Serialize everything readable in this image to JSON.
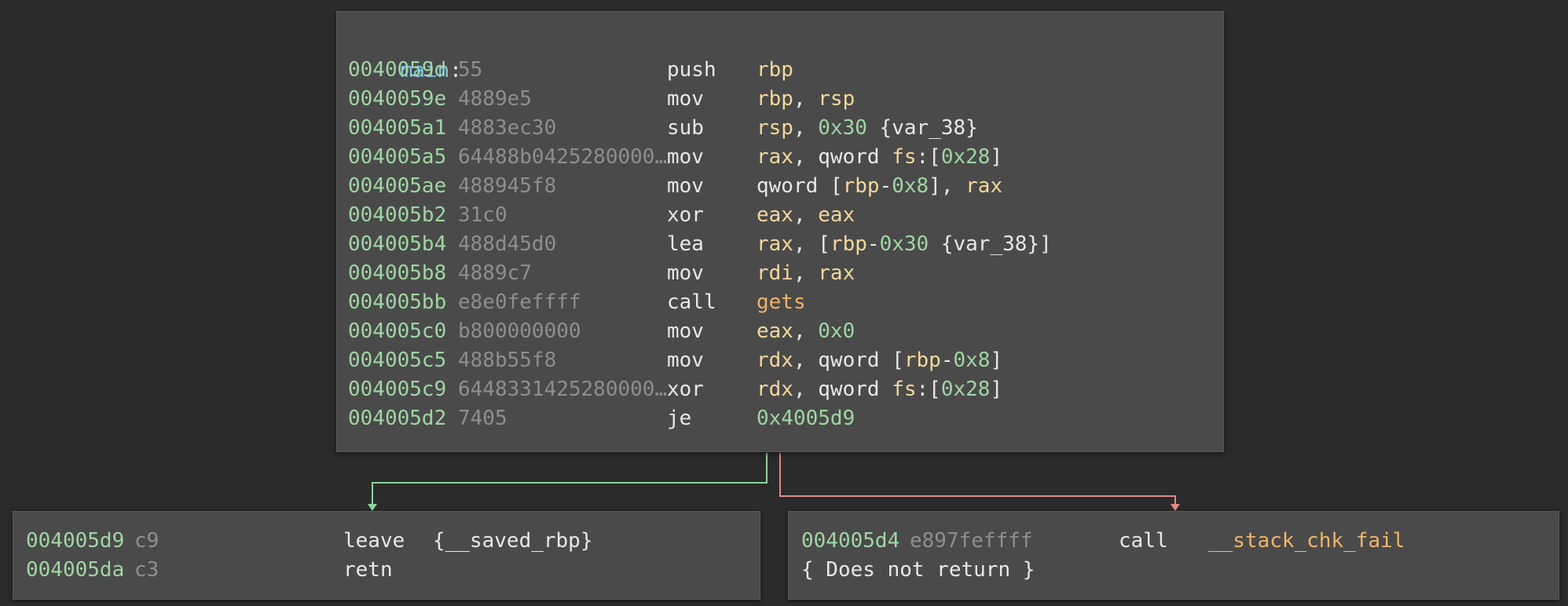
{
  "main_block": {
    "label": "main",
    "label_suffix": ":",
    "instructions": [
      {
        "addr": "0040059d",
        "bytes": "55",
        "mnem": "push",
        "ops": [
          {
            "t": "rbp",
            "k": "reg"
          }
        ]
      },
      {
        "addr": "0040059e",
        "bytes": "4889e5",
        "mnem": "mov",
        "ops": [
          {
            "t": "rbp",
            "k": "reg"
          },
          {
            "t": ", ",
            "k": "plain"
          },
          {
            "t": "rsp",
            "k": "reg"
          }
        ]
      },
      {
        "addr": "004005a1",
        "bytes": "4883ec30",
        "mnem": "sub",
        "ops": [
          {
            "t": "rsp",
            "k": "reg"
          },
          {
            "t": ", ",
            "k": "plain"
          },
          {
            "t": "0x30",
            "k": "num"
          },
          {
            "t": " {var_38}",
            "k": "plain"
          }
        ]
      },
      {
        "addr": "004005a5",
        "bytes": "64488b0425280000…",
        "mnem": "mov",
        "ops": [
          {
            "t": "rax",
            "k": "reg"
          },
          {
            "t": ", qword ",
            "k": "plain"
          },
          {
            "t": "fs",
            "k": "reg"
          },
          {
            "t": ":[",
            "k": "plain"
          },
          {
            "t": "0x28",
            "k": "num"
          },
          {
            "t": "]",
            "k": "plain"
          }
        ]
      },
      {
        "addr": "004005ae",
        "bytes": "488945f8",
        "mnem": "mov",
        "ops": [
          {
            "t": "qword [",
            "k": "plain"
          },
          {
            "t": "rbp",
            "k": "reg"
          },
          {
            "t": "-",
            "k": "plain"
          },
          {
            "t": "0x8",
            "k": "num"
          },
          {
            "t": "], ",
            "k": "plain"
          },
          {
            "t": "rax",
            "k": "reg"
          }
        ]
      },
      {
        "addr": "004005b2",
        "bytes": "31c0",
        "mnem": "xor",
        "ops": [
          {
            "t": "eax",
            "k": "reg"
          },
          {
            "t": ", ",
            "k": "plain"
          },
          {
            "t": "eax",
            "k": "reg"
          }
        ]
      },
      {
        "addr": "004005b4",
        "bytes": "488d45d0",
        "mnem": "lea",
        "ops": [
          {
            "t": "rax",
            "k": "reg"
          },
          {
            "t": ", [",
            "k": "plain"
          },
          {
            "t": "rbp",
            "k": "reg"
          },
          {
            "t": "-",
            "k": "plain"
          },
          {
            "t": "0x30",
            "k": "num"
          },
          {
            "t": " {var_38}]",
            "k": "plain"
          }
        ]
      },
      {
        "addr": "004005b8",
        "bytes": "4889c7",
        "mnem": "mov",
        "ops": [
          {
            "t": "rdi",
            "k": "reg"
          },
          {
            "t": ", ",
            "k": "plain"
          },
          {
            "t": "rax",
            "k": "reg"
          }
        ]
      },
      {
        "addr": "004005bb",
        "bytes": "e8e0feffff",
        "mnem": "call",
        "ops": [
          {
            "t": "gets",
            "k": "sym"
          }
        ]
      },
      {
        "addr": "004005c0",
        "bytes": "b800000000",
        "mnem": "mov",
        "ops": [
          {
            "t": "eax",
            "k": "reg"
          },
          {
            "t": ", ",
            "k": "plain"
          },
          {
            "t": "0x0",
            "k": "num"
          }
        ]
      },
      {
        "addr": "004005c5",
        "bytes": "488b55f8",
        "mnem": "mov",
        "ops": [
          {
            "t": "rdx",
            "k": "reg"
          },
          {
            "t": ", qword [",
            "k": "plain"
          },
          {
            "t": "rbp",
            "k": "reg"
          },
          {
            "t": "-",
            "k": "plain"
          },
          {
            "t": "0x8",
            "k": "num"
          },
          {
            "t": "]",
            "k": "plain"
          }
        ]
      },
      {
        "addr": "004005c9",
        "bytes": "6448331425280000…",
        "mnem": "xor",
        "ops": [
          {
            "t": "rdx",
            "k": "reg"
          },
          {
            "t": ", qword ",
            "k": "plain"
          },
          {
            "t": "fs",
            "k": "reg"
          },
          {
            "t": ":[",
            "k": "plain"
          },
          {
            "t": "0x28",
            "k": "num"
          },
          {
            "t": "]",
            "k": "plain"
          }
        ]
      },
      {
        "addr": "004005d2",
        "bytes": "7405",
        "mnem": "je",
        "ops": [
          {
            "t": "0x4005d9",
            "k": "num"
          }
        ]
      }
    ]
  },
  "left_block": {
    "instructions": [
      {
        "addr": "004005d9",
        "bytes": "c9",
        "mnem": "leave",
        "ops": [
          {
            "t": "{__saved_rbp}",
            "k": "plain"
          }
        ]
      },
      {
        "addr": "004005da",
        "bytes": "c3",
        "mnem": "retn",
        "ops": []
      }
    ]
  },
  "right_block": {
    "instructions": [
      {
        "addr": "004005d4",
        "bytes": "e897feffff",
        "mnem": "call",
        "ops": [
          {
            "t": "__stack_chk_fail",
            "k": "sym"
          }
        ]
      }
    ],
    "note": "{ Does not return }"
  },
  "colors": {
    "background": "#2b2b2b",
    "block": "#4a4a4a",
    "address": "#9fd6a3",
    "bytes": "#8e8e8e",
    "register": "#f2d89c",
    "number": "#9fd6a3",
    "symbol": "#f0b468",
    "label": "#7ec4f0",
    "edge_true": "#8fd3a0",
    "edge_false": "#e08a8a"
  }
}
